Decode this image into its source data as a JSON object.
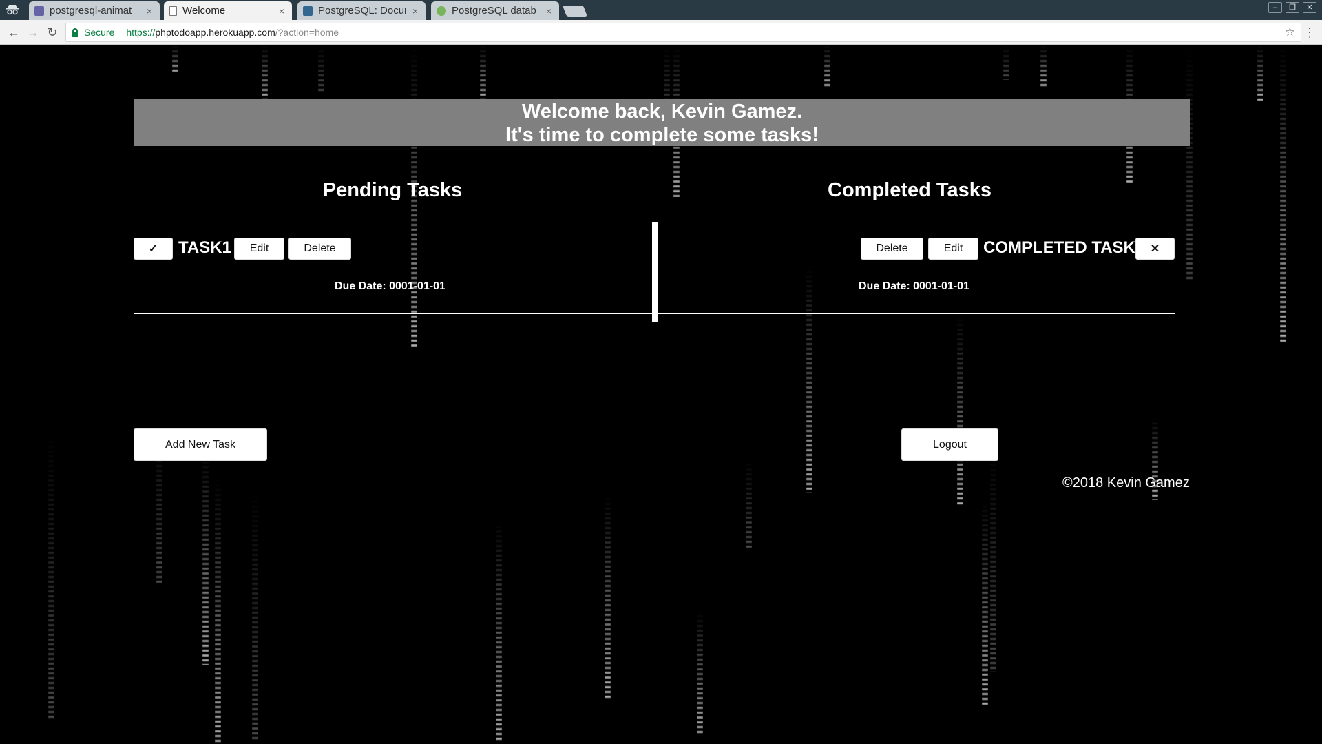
{
  "browser": {
    "tabs": [
      {
        "title": "postgresql-animat",
        "active": false,
        "favicon_color": "#6762a6"
      },
      {
        "title": "Welcome",
        "active": true,
        "favicon_color": "#ffffff"
      },
      {
        "title": "PostgreSQL: Docur",
        "active": false,
        "favicon_color": "#336791"
      },
      {
        "title": "PostgreSQL datab",
        "active": false,
        "favicon_color": "#79b45a"
      }
    ],
    "tab_close_glyph": "×",
    "address": {
      "security_label": "Secure",
      "url_scheme": "https://",
      "url_host": "phptodoapp.herokuapp.com",
      "url_path": "/?action=home"
    }
  },
  "page": {
    "banner": {
      "line1": "Welcome back, Kevin Gamez.",
      "line2": "It's time to complete some tasks!"
    },
    "pending": {
      "title": "Pending Tasks",
      "tasks": [
        {
          "check_label": "✓",
          "name": "TASK1",
          "edit_label": "Edit",
          "delete_label": "Delete",
          "due": "Due Date: 0001-01-01"
        }
      ]
    },
    "completed": {
      "title": "Completed Tasks",
      "tasks": [
        {
          "delete_label": "Delete",
          "edit_label": "Edit",
          "name": "COMPLETED TASK",
          "undo_label": "✕",
          "due": "Due Date: 0001-01-01"
        }
      ]
    },
    "add_task_label": "Add New Task",
    "logout_label": "Logout",
    "footer": "©2018 Kevin Gamez"
  },
  "colors": {
    "background": "#000000",
    "banner": "#808080",
    "text": "#ffffff",
    "tabstrip": "#2a3a44",
    "secure_green": "#0b8043"
  }
}
